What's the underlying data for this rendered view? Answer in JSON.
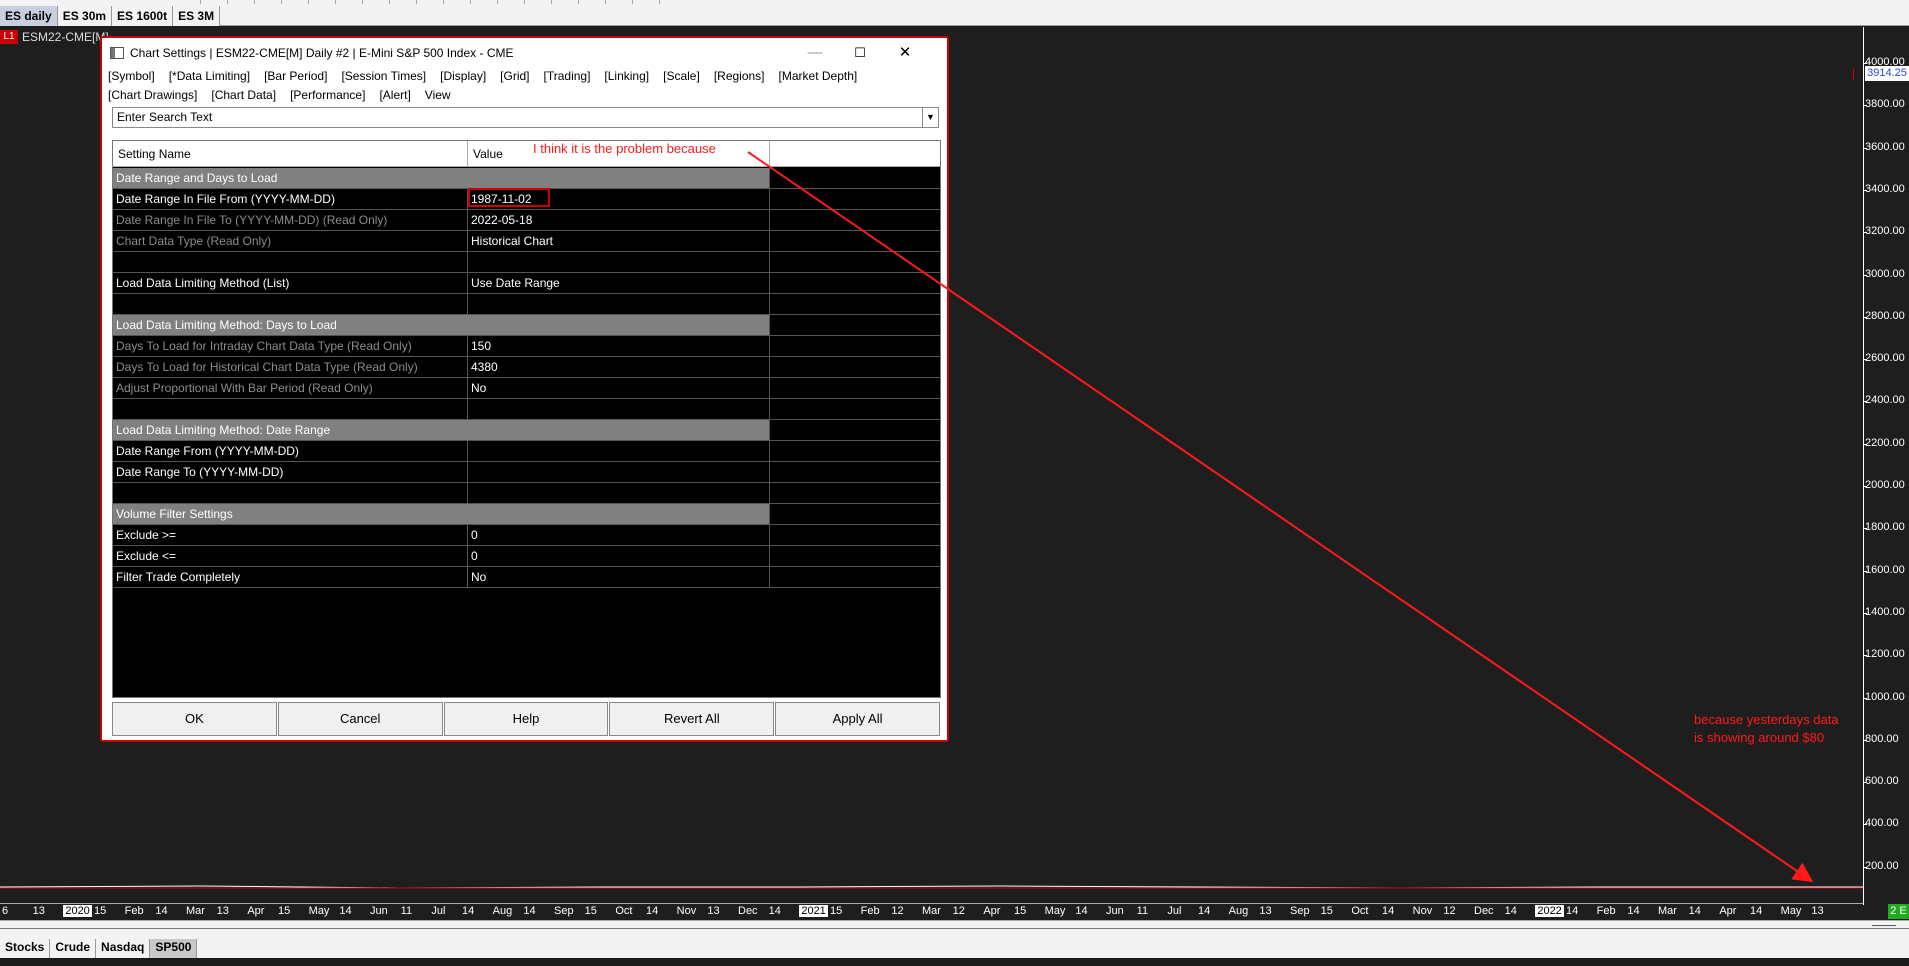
{
  "top_tabs": [
    "ES daily",
    "ES 30m",
    "ES 1600t",
    "ES 3M"
  ],
  "chart": {
    "id_badge": "L1",
    "title": "ESM22-CME[M]",
    "price_tag": "3914.25",
    "y_ticks": [
      "4000.00",
      "3800.00",
      "3600.00",
      "3400.00",
      "3200.00",
      "3000.00",
      "2800.00",
      "2600.00",
      "2400.00",
      "2200.00",
      "2000.00",
      "1800.00",
      "1600.00",
      "1400.00",
      "1200.00",
      "1000.00",
      "800.00",
      "600.00",
      "400.00",
      "200.00"
    ],
    "x_ticks": [
      "6",
      "13",
      "2020",
      "15",
      "Feb",
      "14",
      "Mar",
      "13",
      "Apr",
      "15",
      "May",
      "14",
      "Jun",
      "11",
      "Jul",
      "14",
      "Aug",
      "14",
      "Sep",
      "15",
      "Oct",
      "14",
      "Nov",
      "13",
      "Dec",
      "14",
      "2021",
      "15",
      "Feb",
      "12",
      "Mar",
      "12",
      "Apr",
      "15",
      "May",
      "14",
      "Jun",
      "11",
      "Jul",
      "14",
      "Aug",
      "13",
      "Sep",
      "15",
      "Oct",
      "14",
      "Nov",
      "12",
      "Dec",
      "14",
      "2022",
      "14",
      "Feb",
      "14",
      "Mar",
      "14",
      "Apr",
      "14",
      "May",
      "13"
    ],
    "x_year_ticks": [
      "2020",
      "2021",
      "2022"
    ],
    "x_badge": "2 E",
    "line_color": "#cc0000"
  },
  "bottom_tabs": [
    "Stocks",
    "Crude",
    "Nasdaq",
    "SP500"
  ],
  "dialog": {
    "title": "Chart Settings | ESM22-CME[M]  Daily  #2 | E-Mini S&P 500 Index - CME",
    "minimize": "—",
    "maximize": "☐",
    "close": "✕",
    "menu_row1": [
      "[Symbol]",
      "[*Data Limiting]",
      "[Bar Period]",
      "[Session Times]",
      "[Display]",
      "[Grid]",
      "[Trading]",
      "[Linking]",
      "[Scale]",
      "[Regions]",
      "[Market Depth]"
    ],
    "menu_row2": [
      "[Chart Drawings]",
      "[Chart Data]",
      "[Performance]",
      "[Alert]",
      "View"
    ],
    "search_text": "Enter Search Text",
    "columns": [
      "Setting Name",
      "Value",
      ""
    ],
    "rows": [
      {
        "type": "section",
        "name": "Date Range and Days to Load",
        "value": ""
      },
      {
        "type": "normal",
        "name": "Date Range In File From (YYYY-MM-DD)",
        "value": "1987-11-02"
      },
      {
        "type": "readonly",
        "name": "Date Range In File To (YYYY-MM-DD) (Read Only)",
        "value": "2022-05-18"
      },
      {
        "type": "readonly",
        "name": "Chart Data Type (Read Only)",
        "value": "Historical Chart"
      },
      {
        "type": "blank",
        "name": "",
        "value": ""
      },
      {
        "type": "normal",
        "name": "Load Data Limiting Method (List)",
        "value": "Use Date Range"
      },
      {
        "type": "blank",
        "name": "",
        "value": ""
      },
      {
        "type": "section",
        "name": "Load Data Limiting Method: Days to Load",
        "value": ""
      },
      {
        "type": "readonly",
        "name": "Days To Load for Intraday Chart Data Type (Read Only)",
        "value": "150"
      },
      {
        "type": "readonly",
        "name": "Days To Load for Historical Chart Data Type (Read Only)",
        "value": "4380"
      },
      {
        "type": "readonly",
        "name": "Adjust Proportional With Bar Period (Read Only)",
        "value": "No"
      },
      {
        "type": "blank",
        "name": "",
        "value": ""
      },
      {
        "type": "section",
        "name": "Load Data Limiting Method: Date Range",
        "value": ""
      },
      {
        "type": "normal",
        "name": "Date Range From (YYYY-MM-DD)",
        "value": ""
      },
      {
        "type": "normal",
        "name": "Date Range To (YYYY-MM-DD)",
        "value": ""
      },
      {
        "type": "blank",
        "name": "",
        "value": ""
      },
      {
        "type": "section",
        "name": "Volume Filter Settings",
        "value": ""
      },
      {
        "type": "normal",
        "name": "Exclude >=",
        "value": "0"
      },
      {
        "type": "normal",
        "name": "Exclude <=",
        "value": "0"
      },
      {
        "type": "normal",
        "name": "Filter Trade Completely",
        "value": "No"
      }
    ],
    "buttons": [
      "OK",
      "Cancel",
      "Help",
      "Revert All",
      "Apply All"
    ]
  },
  "annotations": {
    "top": "I think it is the problem because",
    "bottom_line1": "because yesterdays data",
    "bottom_line2": "is showing around $80",
    "color": "#ff1a1a"
  }
}
